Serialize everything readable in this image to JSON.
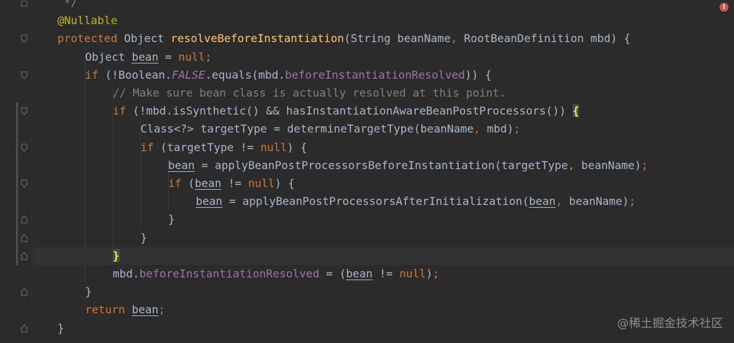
{
  "theme": {
    "background": "#2b2b2b",
    "current_line": "#323232",
    "plain": "#a9b7c6",
    "keyword": "#cc7832",
    "annotation": "#bbb529",
    "function": "#ffc66d",
    "field": "#9876aa",
    "comment": "#808080"
  },
  "editor": {
    "error_indicator_icon": "error-icon",
    "error_indicator_text": "!",
    "current_line_index": 14,
    "lines": [
      {
        "indent": 0,
        "tokens": [
          {
            "t": " */",
            "c": "comment"
          }
        ]
      },
      {
        "indent": 0,
        "tokens": [
          {
            "t": "@Nullable",
            "c": "ann"
          }
        ]
      },
      {
        "indent": 0,
        "tokens": [
          {
            "t": "protected",
            "c": "kw"
          },
          {
            "t": " Object "
          },
          {
            "t": "resolveBeforeInstantiation",
            "c": "fn"
          },
          {
            "t": "(String beanName"
          },
          {
            "t": ",",
            "c": "kw"
          },
          {
            "t": " RootBeanDefinition mbd) {"
          }
        ]
      },
      {
        "indent": 1,
        "tokens": [
          {
            "t": "Object "
          },
          {
            "t": "bean",
            "u": true
          },
          {
            "t": " = "
          },
          {
            "t": "null",
            "c": "kw"
          },
          {
            "t": ";",
            "c": "kw"
          }
        ]
      },
      {
        "indent": 1,
        "tokens": [
          {
            "t": "if",
            "c": "kw"
          },
          {
            "t": " (!Boolean."
          },
          {
            "t": "FALSE",
            "c": "const"
          },
          {
            "t": ".equals(mbd."
          },
          {
            "t": "beforeInstantiationResolved",
            "c": "field"
          },
          {
            "t": ")) {"
          }
        ]
      },
      {
        "indent": 2,
        "tokens": [
          {
            "t": "// Make sure bean class is actually resolved at this point.",
            "c": "comment"
          }
        ]
      },
      {
        "indent": 2,
        "tokens": [
          {
            "t": "if",
            "c": "kw"
          },
          {
            "t": " (!mbd.isSynthetic() && hasInstantiationAwareBeanPostProcessors()) "
          },
          {
            "t": "{",
            "c": "brace"
          }
        ]
      },
      {
        "indent": 3,
        "tokens": [
          {
            "t": "Class<?> targetType = determineTargetType(beanName"
          },
          {
            "t": ",",
            "c": "kw"
          },
          {
            "t": " mbd)"
          },
          {
            "t": ";",
            "c": "kw"
          }
        ]
      },
      {
        "indent": 3,
        "tokens": [
          {
            "t": "if",
            "c": "kw"
          },
          {
            "t": " (targetType != "
          },
          {
            "t": "null",
            "c": "kw"
          },
          {
            "t": ") {"
          }
        ]
      },
      {
        "indent": 4,
        "tokens": [
          {
            "t": "bean",
            "u": true
          },
          {
            "t": " = applyBeanPostProcessorsBeforeInstantiation(targetType"
          },
          {
            "t": ",",
            "c": "kw"
          },
          {
            "t": " beanName)"
          },
          {
            "t": ";",
            "c": "kw"
          }
        ]
      },
      {
        "indent": 4,
        "tokens": [
          {
            "t": "if",
            "c": "kw"
          },
          {
            "t": " ("
          },
          {
            "t": "bean",
            "u": true
          },
          {
            "t": " != "
          },
          {
            "t": "null",
            "c": "kw"
          },
          {
            "t": ") {"
          }
        ]
      },
      {
        "indent": 5,
        "tokens": [
          {
            "t": "bean",
            "u": true
          },
          {
            "t": " = applyBeanPostProcessorsAfterInitialization("
          },
          {
            "t": "bean",
            "u": true
          },
          {
            "t": ",",
            "c": "kw"
          },
          {
            "t": " beanName)"
          },
          {
            "t": ";",
            "c": "kw"
          }
        ]
      },
      {
        "indent": 4,
        "tokens": [
          {
            "t": "}"
          }
        ]
      },
      {
        "indent": 3,
        "tokens": [
          {
            "t": "}"
          }
        ]
      },
      {
        "indent": 2,
        "tokens": [
          {
            "t": "}",
            "c": "brace"
          }
        ]
      },
      {
        "indent": 2,
        "tokens": [
          {
            "t": "mbd."
          },
          {
            "t": "beforeInstantiationResolved",
            "c": "field"
          },
          {
            "t": " = ("
          },
          {
            "t": "bean",
            "u": true
          },
          {
            "t": " != "
          },
          {
            "t": "null",
            "c": "kw"
          },
          {
            "t": ")"
          },
          {
            "t": ";",
            "c": "kw"
          }
        ]
      },
      {
        "indent": 1,
        "tokens": [
          {
            "t": "}"
          }
        ]
      },
      {
        "indent": 1,
        "tokens": [
          {
            "t": "return",
            "c": "kw"
          },
          {
            "t": " "
          },
          {
            "t": "bean",
            "u": true
          },
          {
            "t": ";",
            "c": "kw"
          }
        ]
      },
      {
        "indent": 0,
        "tokens": [
          {
            "t": "}"
          }
        ]
      }
    ],
    "folds": [
      {
        "line": 0,
        "kind": "end"
      },
      {
        "line": 2,
        "kind": "start"
      },
      {
        "line": 4,
        "kind": "start"
      },
      {
        "line": 6,
        "kind": "start"
      },
      {
        "line": 8,
        "kind": "start"
      },
      {
        "line": 10,
        "kind": "start"
      },
      {
        "line": 12,
        "kind": "end"
      },
      {
        "line": 13,
        "kind": "end"
      },
      {
        "line": 14,
        "kind": "end"
      },
      {
        "line": 16,
        "kind": "end"
      },
      {
        "line": 18,
        "kind": "end"
      }
    ]
  },
  "watermark": "@稀土掘金技术社区"
}
